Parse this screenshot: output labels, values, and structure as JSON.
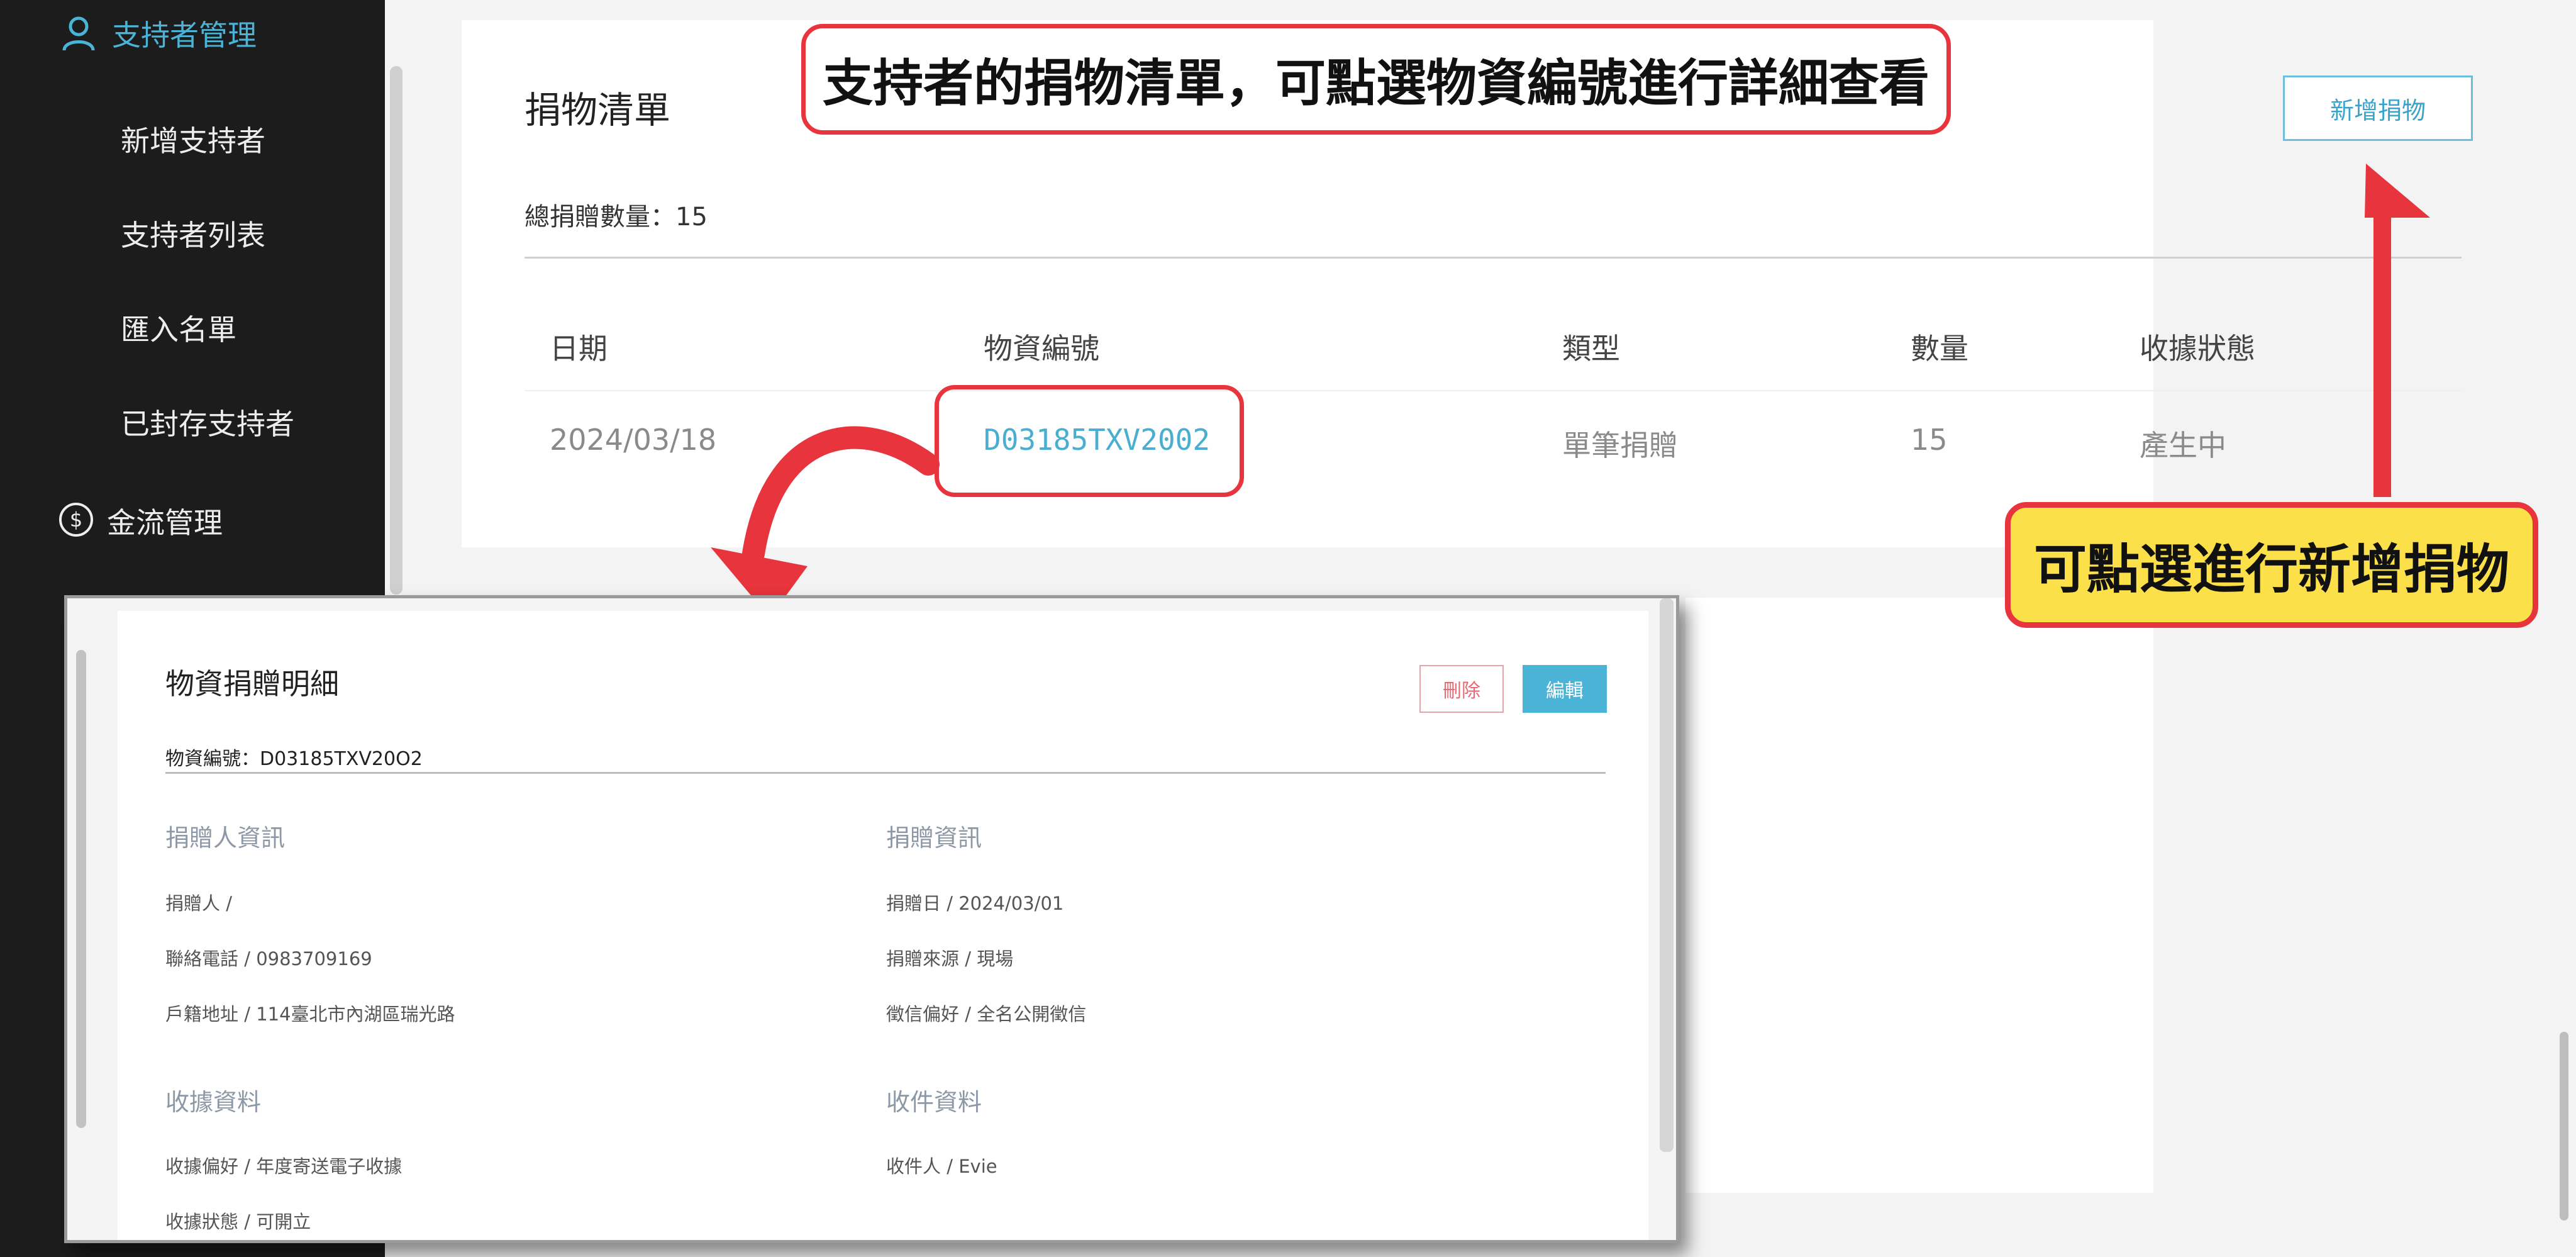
{
  "sidebar": {
    "supporter_section": "支持者管理",
    "items": [
      "新增支持者",
      "支持者列表",
      "匯入名單",
      "已封存支持者"
    ],
    "money_section": "金流管理"
  },
  "main": {
    "title": "捐物清單",
    "total_label": "總捐贈數量：15",
    "add_button": "新增捐物",
    "columns": [
      "日期",
      "物資編號",
      "類型",
      "數量",
      "收據狀態"
    ],
    "rows": [
      {
        "date": "2024/03/18",
        "item_no": "D03185TXV2002",
        "type": "單筆捐贈",
        "qty": "15",
        "receipt": "產生中"
      }
    ]
  },
  "annotations": {
    "main_callout": "支持者的捐物清單，可點選物資編號進行詳細查看",
    "add_callout": "可點選進行新增捐物"
  },
  "detail": {
    "title": "物資捐贈明細",
    "delete_button": "刪除",
    "edit_button": "編輯",
    "item_id": "物資編號：D03185TXV20O2",
    "donor_section": "捐贈人資訊",
    "donation_section": "捐贈資訊",
    "receipt_section": "收據資料",
    "recipient_section": "收件資料",
    "donor_name": "捐贈人 /",
    "donor_phone": "聯絡電話 / 0983709169",
    "donor_address": "戶籍地址 / 114臺北市內湖區瑞光路",
    "donation_date": "捐贈日 / 2024/03/01",
    "donation_source": "捐贈來源 / 現場",
    "acknowledgement_pref": "徵信偏好 / 全名公開徵信",
    "receipt_pref": "收據偏好 / 年度寄送電子收據",
    "receipt_status": "收據狀態 / 可開立",
    "recipient_name": "收件人 / Evie"
  },
  "colors": {
    "accent": "#4ab3d6",
    "sidebar_bg": "#1c1c1c",
    "annotation_red": "#e8343c",
    "annotation_yellow": "#fbe04a"
  }
}
